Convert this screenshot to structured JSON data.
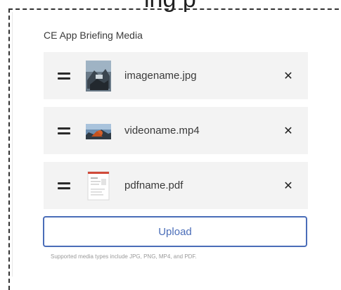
{
  "backdrop": {
    "cropped_text": "ing p"
  },
  "media": {
    "title": "CE App Briefing Media",
    "items": [
      {
        "filename": "imagename.jpg",
        "type": "image",
        "thumb_icon": "image-thumbnail"
      },
      {
        "filename": "videoname.mp4",
        "type": "video",
        "thumb_icon": "video-thumbnail"
      },
      {
        "filename": "pdfname.pdf",
        "type": "pdf",
        "thumb_icon": "pdf-thumbnail"
      }
    ],
    "remove_symbol": "✕",
    "upload_label": "Upload",
    "hint": "Supported media types include JPG, PNG, MP4, and PDF."
  },
  "colors": {
    "accent": "#4a6db8",
    "row_bg": "#f3f3f3",
    "text": "#3a3a3a"
  }
}
